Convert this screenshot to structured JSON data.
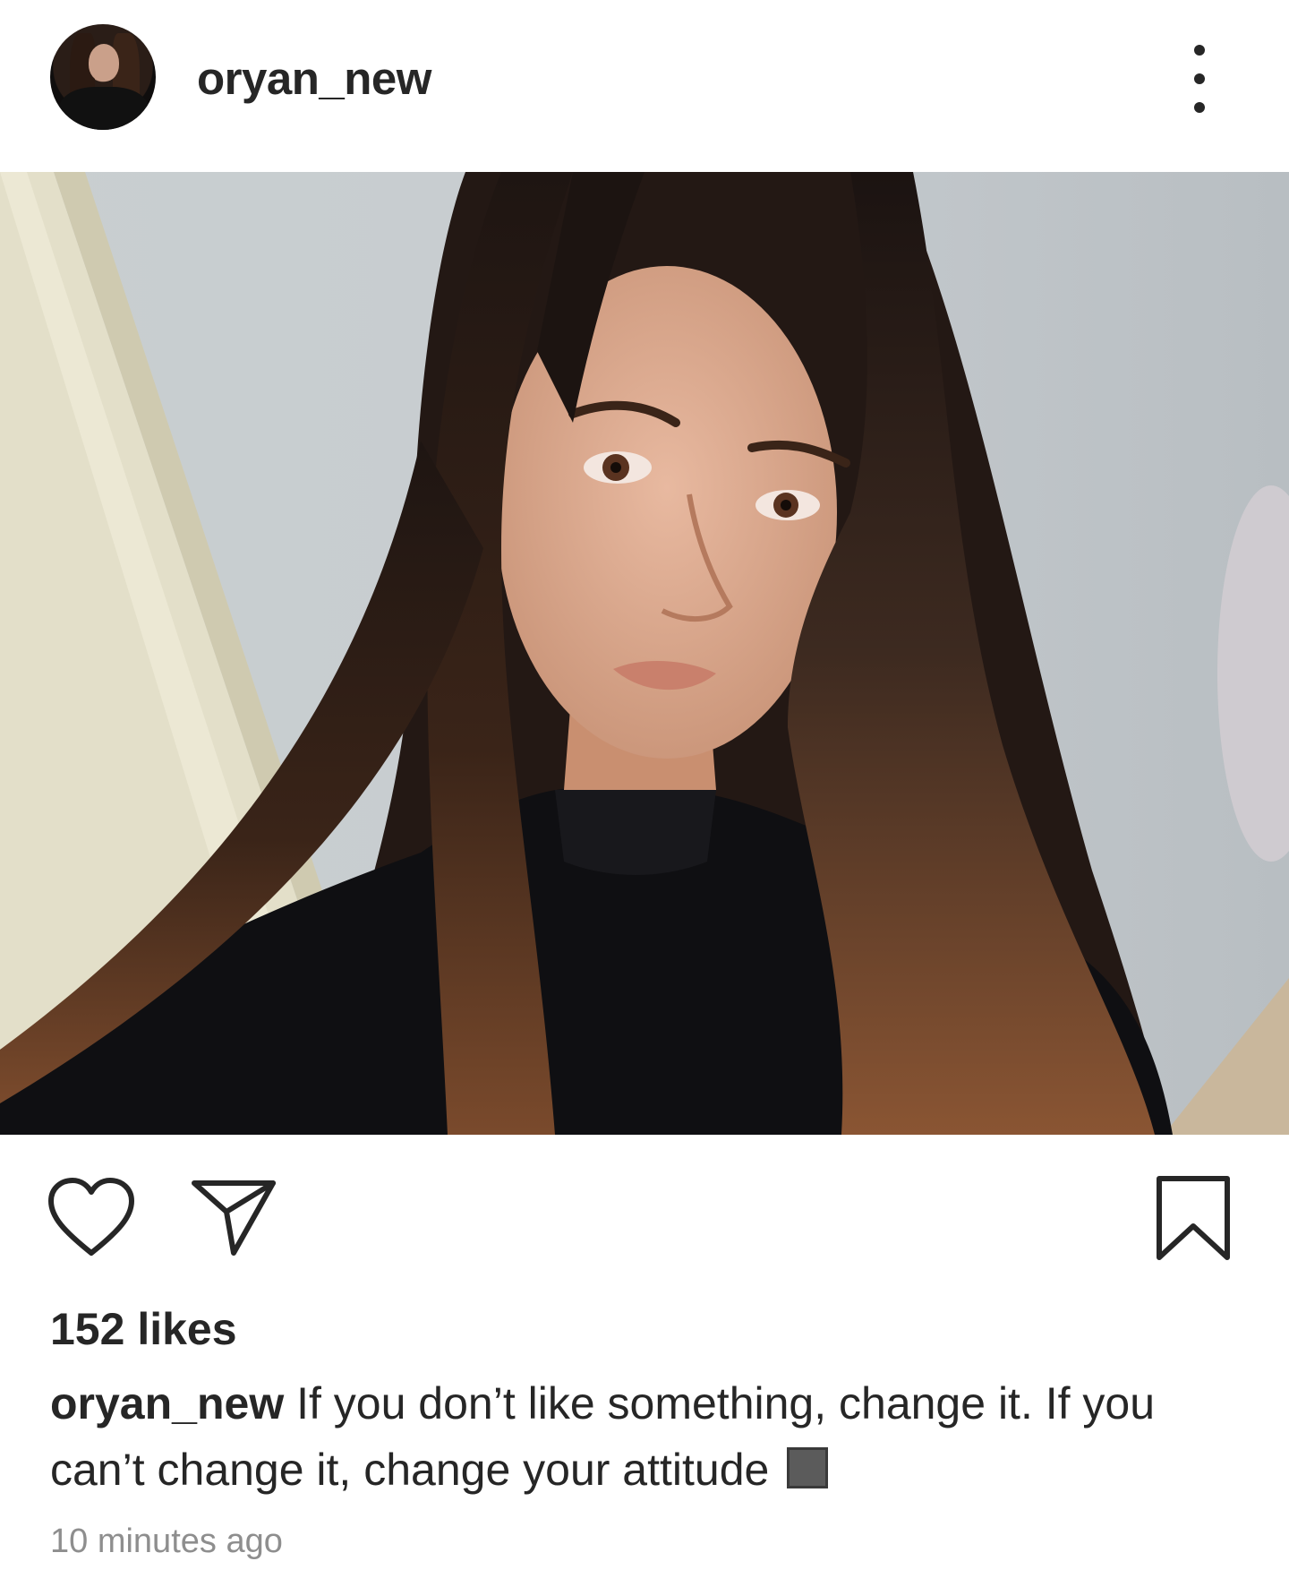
{
  "post": {
    "author": {
      "username": "oryan_new",
      "avatar_icon": "profile-avatar"
    },
    "menu_icon": "more-vertical-icon",
    "image": {
      "description_icon": "selfie-photo"
    },
    "actions": {
      "like_icon": "heart-icon",
      "share_icon": "send-icon",
      "save_icon": "bookmark-icon"
    },
    "likes": "152 likes",
    "caption": {
      "username": "oryan_new",
      "text": "If you don’t like something, change it.  If you can’t change it, change your attitude",
      "emoji_icon": "square-emoji"
    },
    "timestamp": "10 minutes ago"
  },
  "colors": {
    "text": "#262626",
    "muted": "#8e8e8e",
    "background": "#ffffff"
  }
}
